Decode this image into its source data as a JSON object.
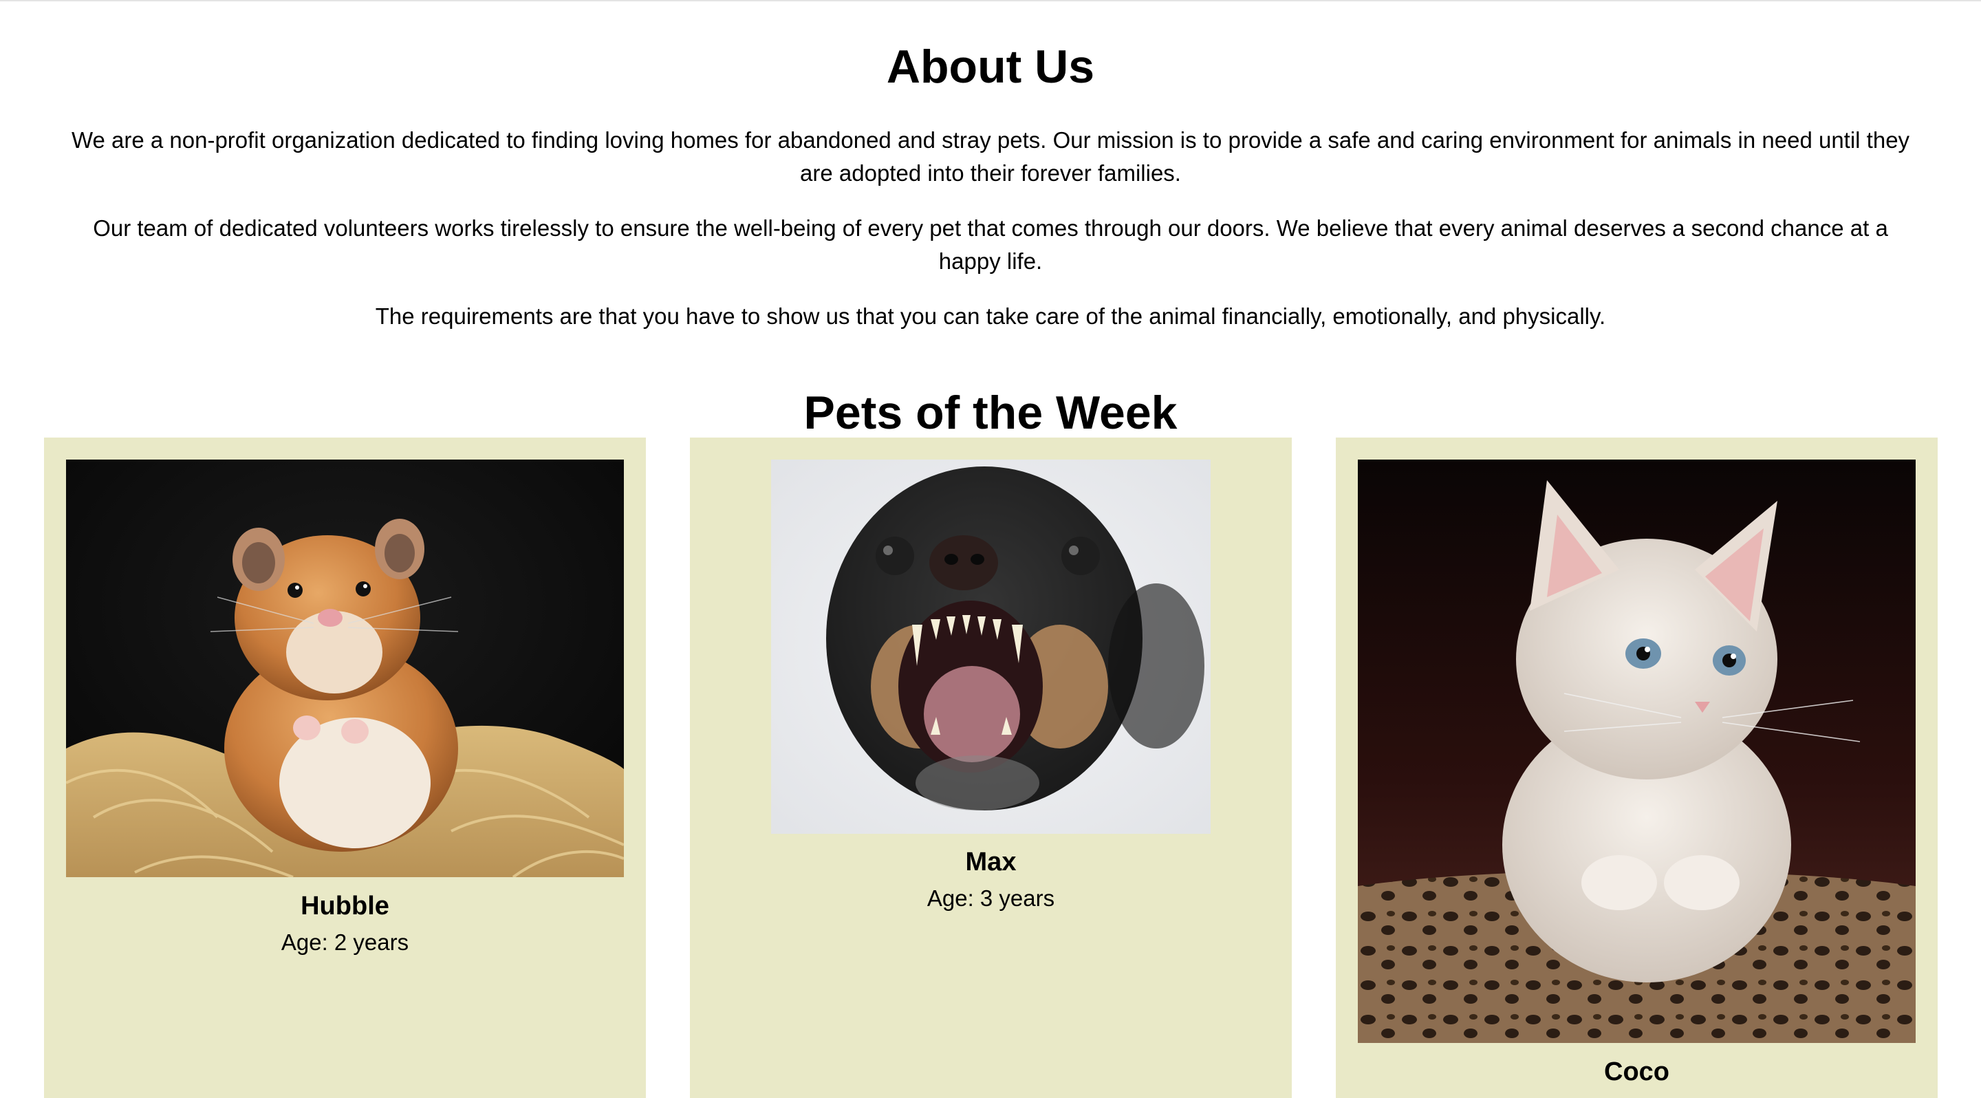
{
  "about": {
    "title": "About Us",
    "paragraphs": [
      "We are a non-profit organization dedicated to finding loving homes for abandoned and stray pets. Our mission is to provide a safe and caring environment for animals in need until they are adopted into their forever families.",
      "Our team of dedicated volunteers works tirelessly to ensure the well-being of every pet that comes through our doors. We believe that every animal deserves a second chance at a happy life.",
      "The requirements are that you have to show us that you can take care of the animal financially, emotionally, and physically."
    ]
  },
  "pets_section": {
    "title": "Pets of the Week",
    "card_color": "#e9e9c7",
    "pets": [
      {
        "name": "Hubble",
        "age": "Age: 2 years"
      },
      {
        "name": "Max",
        "age": "Age: 3 years"
      },
      {
        "name": "Coco",
        "age": ""
      }
    ]
  }
}
